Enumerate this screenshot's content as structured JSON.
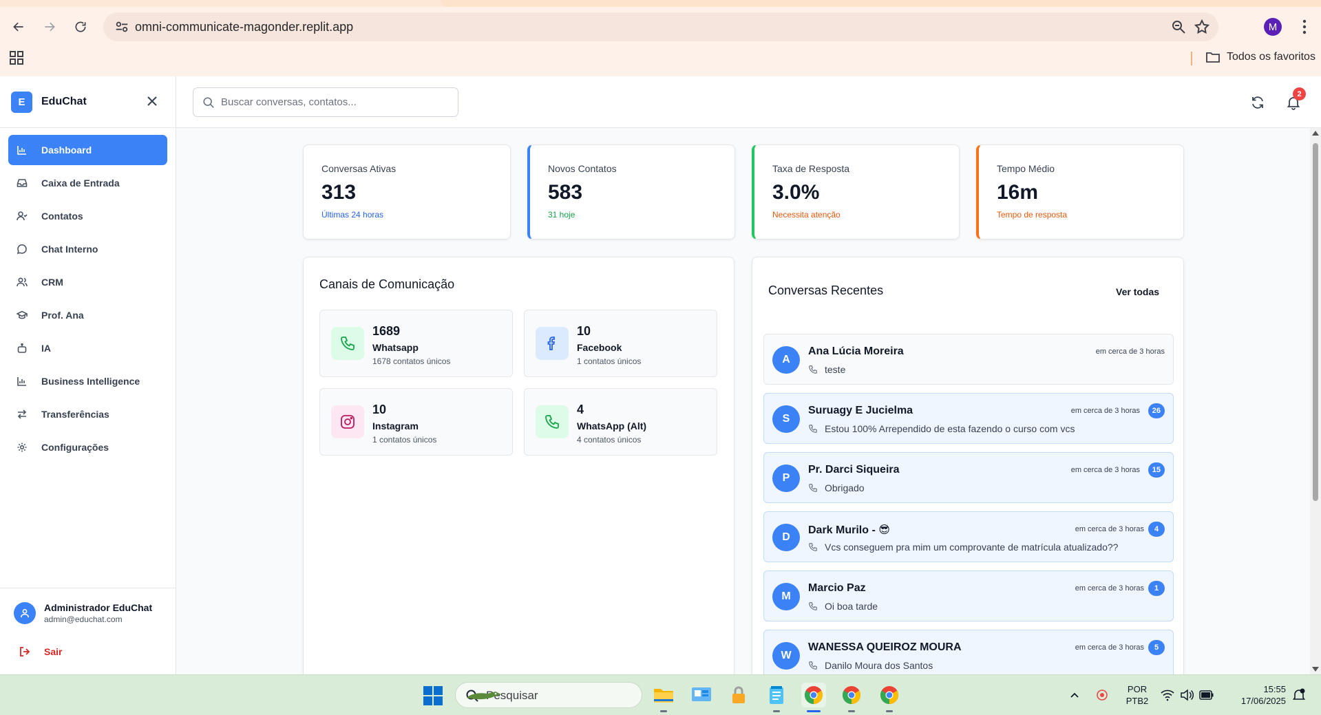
{
  "browser": {
    "url": "omni-communicate-magonder.replit.app",
    "profile_initial": "M",
    "bookmarks_all": "Todos os favoritos"
  },
  "sidebar": {
    "logo_letter": "E",
    "brand": "EduChat",
    "items": [
      {
        "label": "Dashboard",
        "icon": "bar-chart-icon"
      },
      {
        "label": "Caixa de Entrada",
        "icon": "inbox-icon"
      },
      {
        "label": "Contatos",
        "icon": "user-check-icon"
      },
      {
        "label": "Chat Interno",
        "icon": "message-circle-icon"
      },
      {
        "label": "CRM",
        "icon": "users-icon"
      },
      {
        "label": "Prof. Ana",
        "icon": "graduation-cap-icon"
      },
      {
        "label": "IA",
        "icon": "bot-icon"
      },
      {
        "label": "Business Intelligence",
        "icon": "bar-chart-icon"
      },
      {
        "label": "Transferências",
        "icon": "arrows-icon"
      },
      {
        "label": "Configurações",
        "icon": "gear-icon"
      }
    ],
    "user": {
      "name": "Administrador EduChat",
      "email": "admin@educhat.com"
    },
    "logout_label": "Sair"
  },
  "topbar": {
    "search_placeholder": "Buscar conversas, contatos...",
    "notification_count": "2"
  },
  "stats": [
    {
      "label": "Conversas Ativas",
      "value": "313",
      "sub": "Últimas 24 horas",
      "sub_color": "#2563eb",
      "border_color": "#e5e7eb"
    },
    {
      "label": "Novos Contatos",
      "value": "583",
      "sub": "31 hoje",
      "sub_color": "#16a34a",
      "border_color": "#3b82f6"
    },
    {
      "label": "Taxa de Resposta",
      "value": "3.0%",
      "sub": "Necessita atenção",
      "sub_color": "#ea580c",
      "border_color": "#22c55e"
    },
    {
      "label": "Tempo Médio",
      "value": "16m",
      "sub": "Tempo de resposta",
      "sub_color": "#ea580c",
      "border_color": "#f97316"
    }
  ],
  "channels_panel": {
    "title": "Canais de Comunicação",
    "channels": [
      {
        "count": "1689",
        "name": "Whatsapp",
        "sub": "1678 contatos únicos",
        "icon": "phone-icon",
        "color": "#16a34a",
        "bg": "#dcfce7"
      },
      {
        "count": "10",
        "name": "Facebook",
        "sub": "1 contatos únicos",
        "icon": "facebook-icon",
        "color": "#2563eb",
        "bg": "#dbeafe"
      },
      {
        "count": "10",
        "name": "Instagram",
        "sub": "1 contatos únicos",
        "icon": "instagram-icon",
        "color": "#db2777",
        "bg": "#fce7f3"
      },
      {
        "count": "4",
        "name": "WhatsApp (Alt)",
        "sub": "4 contatos únicos",
        "icon": "phone-icon",
        "color": "#16a34a",
        "bg": "#dcfce7"
      }
    ]
  },
  "recent_panel": {
    "title": "Conversas Recentes",
    "see_all": "Ver todas",
    "conversations": [
      {
        "initial": "A",
        "name": "Ana Lúcia Moreira",
        "time": "em cerca de 3 horas",
        "message": "teste",
        "unread": ""
      },
      {
        "initial": "S",
        "name": "Suruagy E Jucielma",
        "time": "em cerca de 3 horas",
        "message": "Estou 100% Arrependido de esta fazendo o curso com vcs",
        "unread": "26"
      },
      {
        "initial": "P",
        "name": "Pr. Darci Siqueira",
        "time": "em cerca de 3 horas",
        "message": "Obrigado",
        "unread": "15"
      },
      {
        "initial": "D",
        "name": "Dark Murilo - 😎",
        "time": "em cerca de 3 horas",
        "message": "Vcs conseguem pra mim um comprovante de matrícula atualizado??",
        "unread": "4"
      },
      {
        "initial": "M",
        "name": "Marcio Paz",
        "time": "em cerca de 3 horas",
        "message": "Oi boa tarde",
        "unread": "1"
      },
      {
        "initial": "W",
        "name": "WANESSA QUEIROZ MOURA",
        "time": "em cerca de 3 horas",
        "message": "Danilo Moura dos Santos",
        "unread": "5"
      }
    ]
  },
  "taskbar": {
    "search_label": "Pesquisar",
    "lang_line1": "POR",
    "lang_line2": "PTB2",
    "time": "15:55",
    "date": "17/06/2025"
  }
}
